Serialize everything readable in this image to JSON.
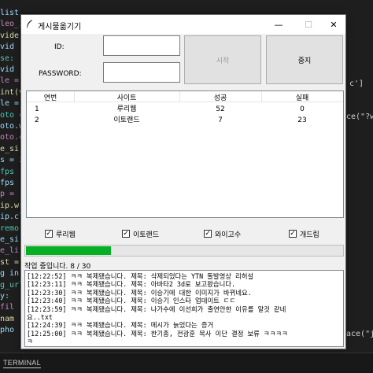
{
  "window": {
    "title": "게시물옮기기",
    "controls": {
      "minimize": "—",
      "maximize": "☐",
      "close": "✕"
    }
  },
  "form": {
    "id_label": "ID:",
    "password_label": "PASSWORD:",
    "id_value": "",
    "password_value": "",
    "start_button": "시작",
    "stop_button": "중지"
  },
  "table": {
    "columns": [
      "연번",
      "사이트",
      "성공",
      "실패"
    ],
    "rows": [
      {
        "no": "1",
        "site": "루리웹",
        "success": "52",
        "fail": "0"
      },
      {
        "no": "2",
        "site": "이토랜드",
        "success": "7",
        "fail": "23"
      }
    ]
  },
  "checkboxes": [
    {
      "label": "루리웹",
      "checked": true
    },
    {
      "label": "이토랜드",
      "checked": true
    },
    {
      "label": "와이고수",
      "checked": true
    },
    {
      "label": "개드립",
      "checked": true
    }
  ],
  "progress": {
    "fraction": 0.267
  },
  "status": {
    "text": "작업 중입니다. 8 / 30"
  },
  "log": [
    "[12:22:52] ㅋㅋ 복제됐습니다. 제목: 삭제되었다는 YTN 돌발영상 리허설",
    "[12:23:11] ㅋㅋ 복제됐습니다. 제목: 아바타2 3d로 보고왔습니다.",
    "[12:23:30] ㅋㅋ 복제됐습니다. 제목: 이승기에 대한 이미지가 바뀌네요.",
    "[12:23:40] ㅋㅋ 복제됐습니다. 제목: 이승기 인스타 업데이트 ㄷㄷ",
    "[12:23:59] ㅋㅋ 복제됐습니다. 제목: 나가수에 이선희가 출연안한 이유를 알것 같네",
    "요..txt",
    "[12:24:39] ㅋㅋ 복제됐습니다. 제목: 메시가 늙었다는 증거",
    "[12:25:00] ㅋㅋ 복제됐습니다. 제목: 한기총, 전광훈 목사 이단 결정 보류 ㅋㅋㅋㅋ",
    "ㅋ"
  ],
  "background": {
    "code_left": [
      "list",
      "leo_i",
      "  vide",
      "  vid",
      "se:",
      "  vid",
      "le =",
      "int(v",
      "le =",
      "oto =",
      "oto.w",
      "oto.cl",
      "e_si",
      "s = i",
      "fps",
      "  fps",
      "p =",
      "ip.wr",
      "ip.cl",
      "remo",
      "e_si",
      "e_li",
      "st =",
      "g in",
      "g_url",
      "y:",
      "  fil",
      "  nam",
      "  pho"
    ],
    "code_right": [
      "c']",
      "ce(\"?we",
      "ace(\"j"
    ],
    "terminal_tab": "TERMINAL"
  }
}
